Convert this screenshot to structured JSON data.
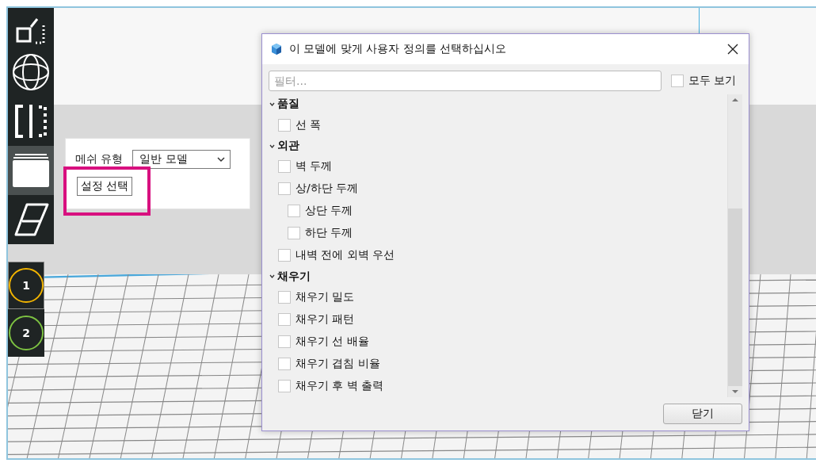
{
  "toolbar": {
    "tools": [
      {
        "kind": "scale",
        "selected": false
      },
      {
        "kind": "rotate",
        "selected": false
      },
      {
        "kind": "mirror",
        "selected": false
      },
      {
        "kind": "per-model",
        "selected": true
      },
      {
        "kind": "support-blocker",
        "selected": false
      }
    ],
    "extruders": [
      {
        "label": "1",
        "color": "#f2b400",
        "selected": true
      },
      {
        "label": "2",
        "color": "#7dc242",
        "selected": false
      }
    ]
  },
  "popover": {
    "mesh_type_label": "메쉬 유형",
    "mesh_type_value": "일반 모델",
    "select_settings_button": "설정 선택"
  },
  "dialog": {
    "title": "이 모델에 맞게 사용자 정의를 선택하십시오",
    "filter_placeholder": "필터...",
    "show_all": {
      "label": "모두 보기",
      "checked": false
    },
    "groups": [
      {
        "title": "품질",
        "expanded": true,
        "items": [
          {
            "label": "선 폭",
            "checked": false
          }
        ]
      },
      {
        "title": "외관",
        "expanded": true,
        "items": [
          {
            "label": "벽 두께",
            "checked": false
          },
          {
            "label": "상/하단 두께",
            "checked": false,
            "children": [
              {
                "label": "상단 두께",
                "checked": false
              },
              {
                "label": "하단 두께",
                "checked": false
              }
            ]
          },
          {
            "label": "내벽 전에 외벽 우선",
            "checked": false
          }
        ]
      },
      {
        "title": "채우기",
        "expanded": true,
        "items": [
          {
            "label": "채우기 밀도",
            "checked": false
          },
          {
            "label": "채우기 패턴",
            "checked": false
          },
          {
            "label": "채우기 선 배율",
            "checked": false
          },
          {
            "label": "채우기 겹침 비율",
            "checked": false
          },
          {
            "label": "채우기 후 벽 출력",
            "checked": false
          }
        ]
      }
    ],
    "close_button": "닫기"
  }
}
